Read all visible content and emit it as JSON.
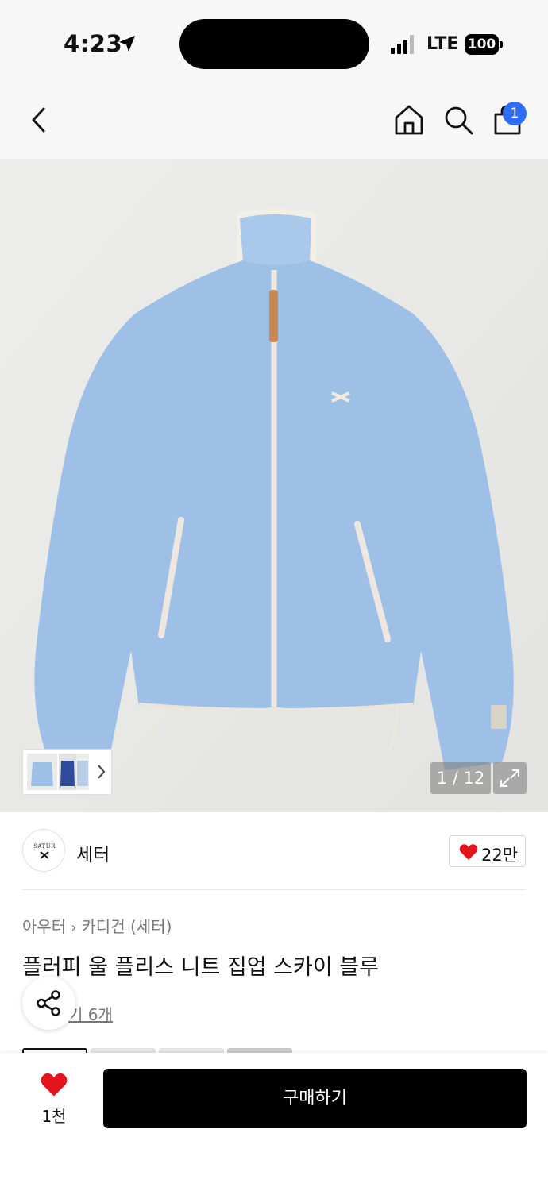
{
  "status_bar": {
    "time": "4:23",
    "network": "LTE",
    "battery": "100"
  },
  "nav": {
    "cart_count": "1"
  },
  "gallery": {
    "counter": "1 / 12"
  },
  "brand": {
    "name": "세터",
    "logo_text": "SATUR",
    "likes": "22만"
  },
  "product": {
    "category": "아우터",
    "subcategory": "카디건 (세터)",
    "title": "플러피 울 플리스 니트 집업 스카이 블루",
    "reviews_partial": "기 6개"
  },
  "bottom_bar": {
    "wish_count": "1천",
    "buy_label": "구매하기"
  },
  "colors": {
    "accent": "#2f6df6",
    "heart": "#e3141b",
    "sweater": "#9fc0e6"
  },
  "icons": [
    "location-arrow-icon",
    "back-chevron-icon",
    "home-icon",
    "search-icon",
    "shopping-bag-icon",
    "expand-icon",
    "heart-icon",
    "share-icon"
  ]
}
